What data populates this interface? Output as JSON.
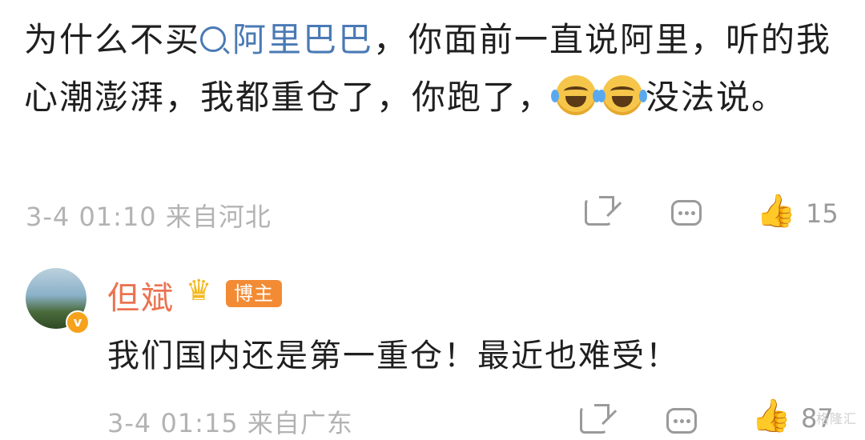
{
  "comment1": {
    "text_before_mention": "为什么不买",
    "mention": "阿里巴巴",
    "text_after_mention": "，你面前一直说阿里，听的我心潮澎湃，我都重仓了，你跑了，",
    "emojis": [
      "laugh-cry-icon",
      "laugh-cry-icon"
    ],
    "text_end": "没法说。",
    "timestamp": "3-4 01:10",
    "location": "来自河北",
    "like_count": "15"
  },
  "reply": {
    "username": "但斌",
    "badge": "博主",
    "verified_mark": "v",
    "text": "我们国内还是第一重仓！最近也难受！",
    "timestamp": "3-4 01:15",
    "location": "来自广东",
    "like_count": "87"
  },
  "watermark": "格隆汇",
  "colors": {
    "mention": "#4a7ab5",
    "username": "#eb7350",
    "badge": "#f28b34",
    "meta": "#b3b3b3"
  }
}
